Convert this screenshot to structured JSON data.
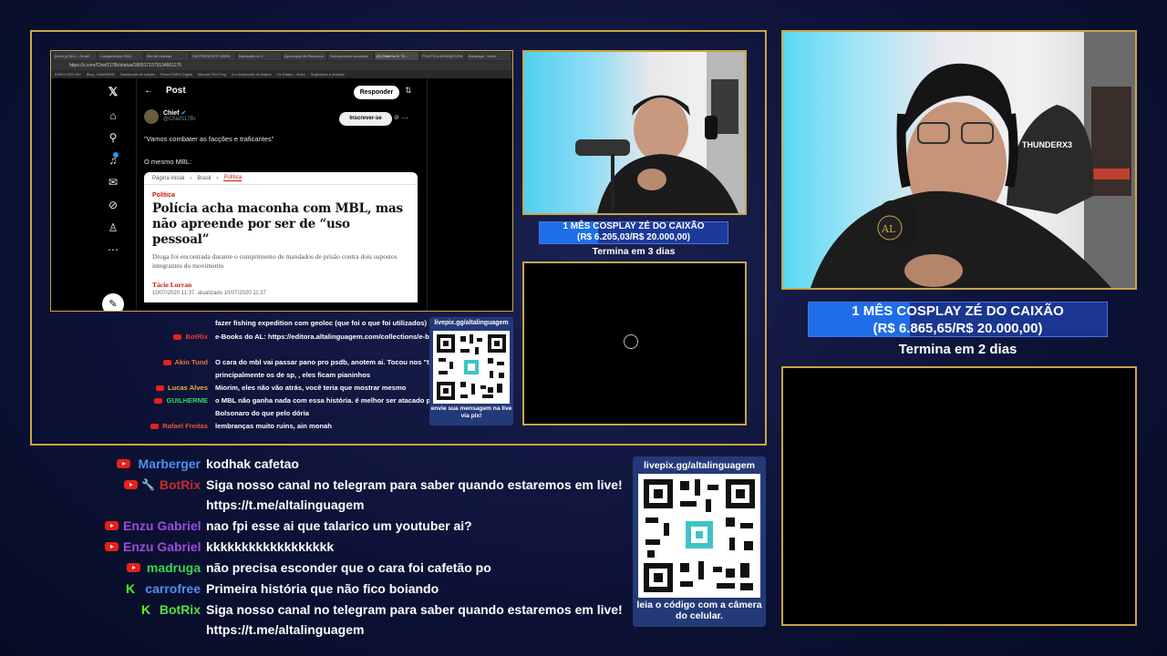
{
  "browser": {
    "tabs": [
      "Inbox (4,561) - Gmail",
      "Lançamentos 2024",
      "Site de notícias",
      "EM PRESENTE OBRA",
      "Marcação no X",
      "Aprovação de Recursos",
      "Notícia sobre comentar",
      "(3) Chief no X: \"V...",
      "POLÍTICA ASSINATURA",
      "Startpage - Inicio"
    ],
    "url": "https://x.com/Chief117Br/status/1805171579104661176",
    "bookmarks": [
      "ENEM 2025 MV",
      "Blog - MIAMIFBR",
      "Dashboard de edição",
      "Plano ENEM Digital",
      "Manual ODS Peg",
      "A e Assistente de Dados",
      "Os Dados - Visão",
      "Sugestões e dúvidas"
    ]
  },
  "tweet": {
    "header": "Post",
    "reply_label": "Responder",
    "author_name": "Chief",
    "author_handle": "@Chief117Br",
    "follow_label": "Inscrever-se",
    "text1": "\"Vamos combater as facções e traficantes\"",
    "text2": "O mesmo MBL:",
    "article": {
      "crumbs": [
        "Página inicial",
        "Brasil",
        "Política"
      ],
      "section": "Política",
      "headline": "Polícia acha maconha com MBL, mas não apreende por ser de “uso pessoal”",
      "subhead": "Droga foi encontrada durante o cumprimento de mandados de prisão contra dois supostos integrantes do movimento",
      "byline": "Tácio Lorran",
      "dateline": "10/07/2020 11:37, atualizado 10/07/2020 11:37"
    }
  },
  "chat_small": [
    {
      "name": "",
      "name_color": "#ffffff",
      "icon": "",
      "msg": "fazer fishing expedition com geoloc (que foi o que foi utilizados)"
    },
    {
      "name": "BotRix",
      "name_color": "#e83b3b",
      "icon": "youtube",
      "msg": "e-Books do AL: https://editora.altalinguagem.com/collections/e-books"
    },
    {
      "name": "Akin Tund",
      "name_color": "#e87a3b",
      "icon": "youtube",
      "msg": "O cara do mbl vai passar pano pro psdb, anotem ai. Tocou nos \"tucanos\", principalmente os de sp, , eles ficam pianinhos"
    },
    {
      "name": "Lucas Alves",
      "name_color": "#e8b13b",
      "icon": "youtube",
      "msg": "Miorim, eles não vão atrás, você teria que mostrar mesmo"
    },
    {
      "name": "GUILHERME",
      "name_color": "#2fd86a",
      "icon": "youtube",
      "msg": "o MBL não ganha nada com essa história. é melhor ser atacado pelo Bolsonaro do que pelo dória"
    },
    {
      "name": "Rafael Freitas",
      "name_color": "#e8563b",
      "icon": "youtube",
      "msg": "lembranças muito ruins, ain monah"
    }
  ],
  "qr_small": {
    "top": "livepix.gg/altalinguagem",
    "bottom": "envie sua mensagem na live via pix!"
  },
  "goal_small": {
    "line1": "1 MÊS COSPLAY ZÉ DO CAIXÃO",
    "line2": "(R$ 6.205,03/R$ 20.000,00)",
    "ends": "Termina em 3 dias",
    "progress": 0.31
  },
  "goal_big": {
    "line1": "1 MÊS COSPLAY ZÉ DO CAIXÃO",
    "line2": "(R$ 6.865,65/R$ 20.000,00)",
    "ends": "Termina em 2 dias",
    "progress": 0.34
  },
  "cam_label": "THUNDERX3",
  "chat_big": [
    {
      "name": "Marberger",
      "name_color": "#4f8ef7",
      "icon": "youtube",
      "msg": "kodhak cafetao"
    },
    {
      "name": "BotRix",
      "name_color": "#c42e2e",
      "icon": "youtube-wrench",
      "msg": "Siga nosso canal no telegram para saber quando estaremos em live!"
    },
    {
      "name": "",
      "name_color": "#ffffff",
      "icon": "",
      "msg": "https://t.me/altalinguagem"
    },
    {
      "name": "Enzu Gabriel",
      "name_color": "#9b4ddc",
      "icon": "youtube",
      "msg": "nao fpi esse ai que talarico um youtuber ai?"
    },
    {
      "name": "Enzu Gabriel",
      "name_color": "#9b4ddc",
      "icon": "youtube",
      "msg": "kkkkkkkkkkkkkkkkkk"
    },
    {
      "name": "madruga",
      "name_color": "#38d64a",
      "icon": "youtube",
      "msg": "não precisa esconder que o cara foi cafetão po"
    },
    {
      "name": "carrofree",
      "name_color": "#4f8ef7",
      "icon": "kick",
      "msg": "Primeira história que não fico boiando"
    },
    {
      "name": "BotRix",
      "name_color": "#53e046",
      "icon": "kick",
      "msg": "Siga nosso canal no telegram para saber quando estaremos em live!"
    },
    {
      "name": "",
      "name_color": "#ffffff",
      "icon": "",
      "msg": "https://t.me/altalinguagem"
    }
  ],
  "qr_big": {
    "top": "livepix.gg/altalinguagem",
    "bottom": "leia o código com a câmera do celular."
  }
}
